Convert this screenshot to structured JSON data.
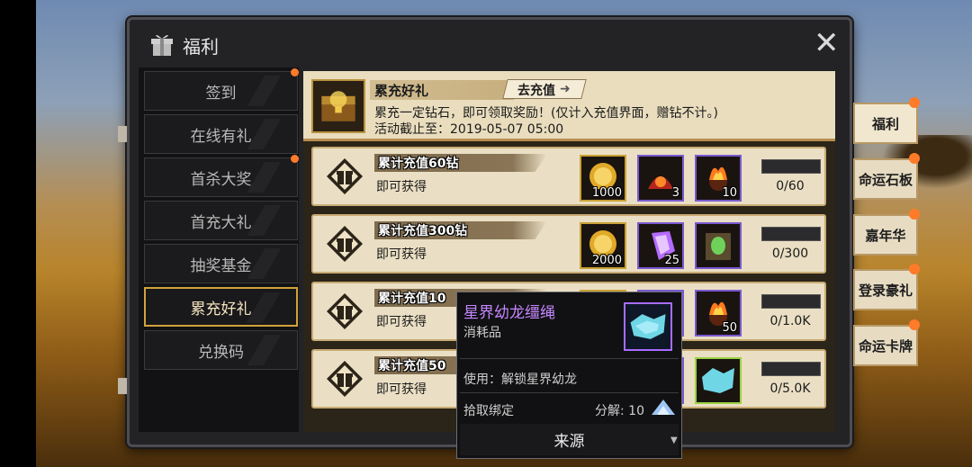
{
  "window": {
    "title": "福利",
    "close": "✕"
  },
  "left_menu": [
    {
      "label": "签到",
      "active": false,
      "badge": true
    },
    {
      "label": "在线有礼",
      "active": false,
      "badge": false
    },
    {
      "label": "首杀大奖",
      "active": false,
      "badge": true
    },
    {
      "label": "首充大礼",
      "active": false,
      "badge": false
    },
    {
      "label": "抽奖基金",
      "active": false,
      "badge": false
    },
    {
      "label": "累充好礼",
      "active": true,
      "badge": false
    },
    {
      "label": "兑换码",
      "active": false,
      "badge": false
    }
  ],
  "banner": {
    "title": "累充好礼",
    "button_label": "去充值",
    "description": "累充一定钻石，即可领取奖励！(仅计入充值界面，赠钻不计。)",
    "deadline": "活动截止至：2019-05-07 05:00"
  },
  "rows": [
    {
      "title": "累计充值60钻",
      "sub": "即可获得",
      "items": [
        {
          "icon": "gold-coin-icon",
          "qty": "1000",
          "frame": "gold"
        },
        {
          "icon": "fire-bag-icon",
          "qty": "3",
          "frame": "purple"
        },
        {
          "icon": "flame-orb-icon",
          "qty": "10",
          "frame": "purple"
        }
      ],
      "progress": "0/60",
      "progress_fraction": 0
    },
    {
      "title": "累计充值300钻",
      "sub": "即可获得",
      "items": [
        {
          "icon": "gold-coin-icon",
          "qty": "2000",
          "frame": "gold"
        },
        {
          "icon": "purple-crystal-icon",
          "qty": "25",
          "frame": "purple"
        },
        {
          "icon": "green-gem-book-icon",
          "qty": "",
          "frame": "purple"
        }
      ],
      "progress": "0/300",
      "progress_fraction": 0
    },
    {
      "title": "累计充值10",
      "sub": "即可获得",
      "items": [
        {
          "icon": "hidden-item-icon",
          "qty": "",
          "frame": "gold"
        },
        {
          "icon": "hidden-item-icon",
          "qty": "",
          "frame": "purple"
        },
        {
          "icon": "flame-orb-icon",
          "qty": "50",
          "frame": "purple"
        }
      ],
      "progress": "0/1.0K",
      "progress_fraction": 0
    },
    {
      "title": "累计充值50",
      "sub": "即可获得",
      "items": [
        {
          "icon": "hidden-item-icon",
          "qty": "",
          "frame": "gold"
        },
        {
          "icon": "hidden-item-icon",
          "qty": "",
          "frame": "purple"
        },
        {
          "icon": "ice-dragon-rein-icon",
          "qty": "",
          "frame": "green"
        }
      ],
      "progress": "0/5.0K",
      "progress_fraction": 0
    }
  ],
  "right_tabs": [
    {
      "label": "福利",
      "badge": true,
      "active": true
    },
    {
      "label": "命运石板",
      "badge": true,
      "active": false
    },
    {
      "label": "嘉年华",
      "badge": true,
      "active": false
    },
    {
      "label": "登录豪礼",
      "badge": true,
      "active": false
    },
    {
      "label": "命运卡牌",
      "badge": true,
      "active": false
    }
  ],
  "tooltip": {
    "name": "星界幼龙缰绳",
    "type": "消耗品",
    "use": "使用：解锁星界幼龙",
    "bind": "拾取绑定",
    "dismantle": "分解: 10",
    "source_button": "来源"
  },
  "colors": {
    "accent_gold": "#d1a33a",
    "badge_orange": "#ff7a29",
    "rare_purple": "#c586ff"
  }
}
